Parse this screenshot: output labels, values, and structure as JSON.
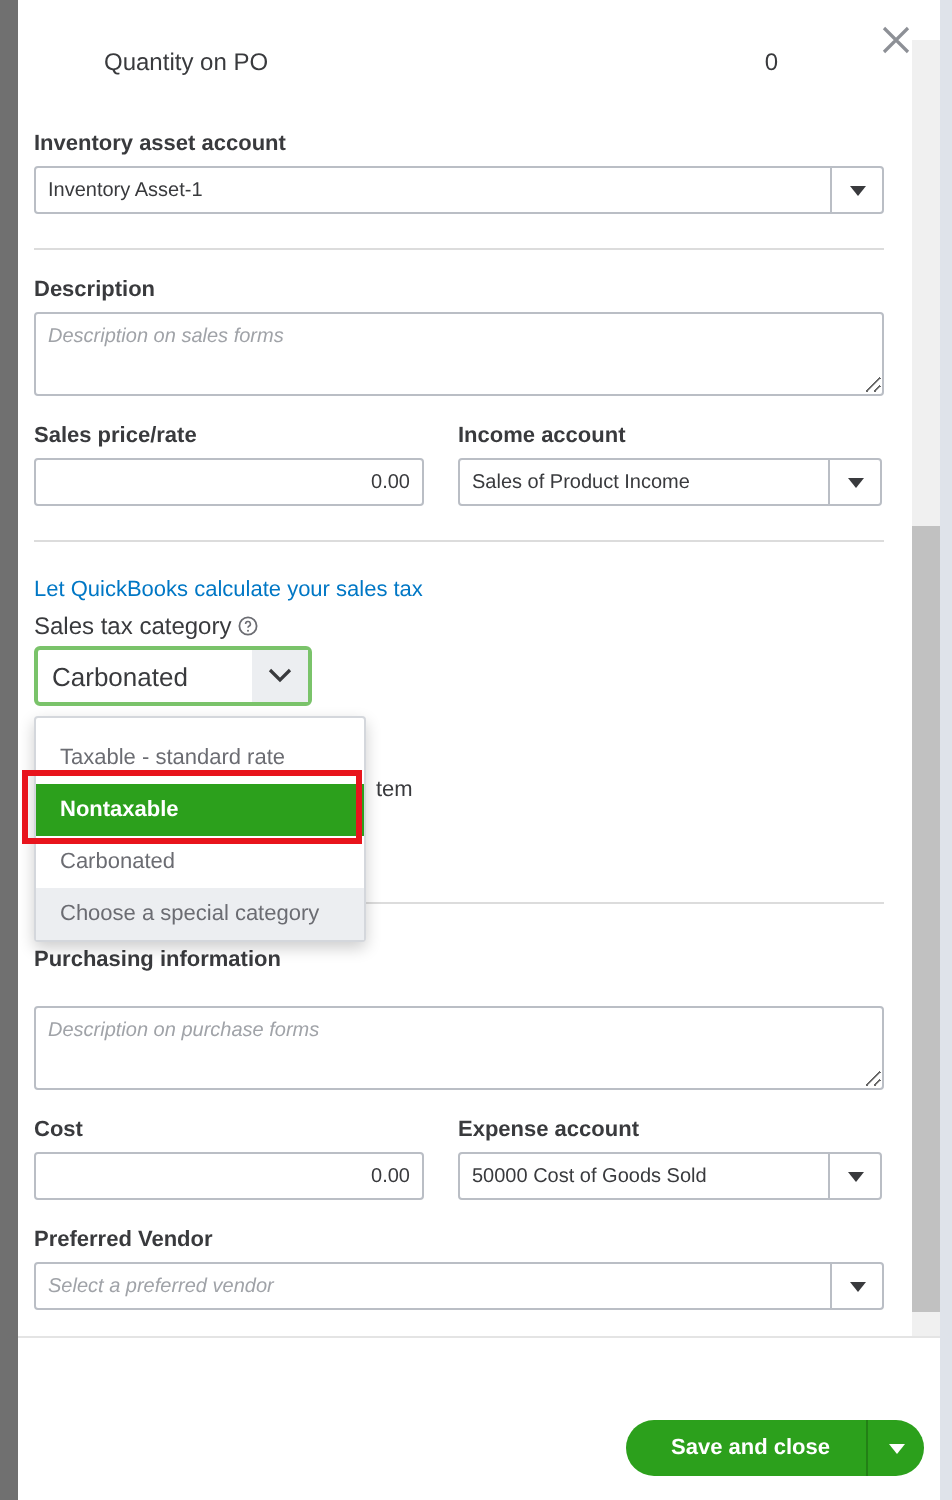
{
  "quantity_on_po": {
    "label": "Quantity on PO",
    "value": "0"
  },
  "inventory_asset_account": {
    "label": "Inventory asset account",
    "value": "Inventory Asset-1"
  },
  "description": {
    "label": "Description",
    "placeholder": "Description on sales forms"
  },
  "sales_price": {
    "label": "Sales price/rate",
    "value": "0.00"
  },
  "income_account": {
    "label": "Income account",
    "value": "Sales of Product Income"
  },
  "tax_link": "Let QuickBooks calculate your sales tax",
  "sales_tax_category": {
    "label": "Sales tax category",
    "value": "Carbonated",
    "expanded": true,
    "options": [
      {
        "label": "Taxable - standard rate",
        "kind": "option",
        "highlighted": false,
        "annotated": false
      },
      {
        "label": "Nontaxable",
        "kind": "option",
        "highlighted": true,
        "annotated": true
      },
      {
        "label": "Carbonated",
        "kind": "option",
        "highlighted": false,
        "annotated": false
      },
      {
        "label": "Choose a special category",
        "kind": "special",
        "highlighted": false,
        "annotated": false
      }
    ]
  },
  "covered_row_text": "tem",
  "purchasing": {
    "heading": "Purchasing information",
    "placeholder": "Description on purchase forms"
  },
  "cost": {
    "label": "Cost",
    "value": "0.00"
  },
  "expense_account": {
    "label": "Expense account",
    "value": "50000 Cost of Goods Sold"
  },
  "preferred_vendor": {
    "label": "Preferred Vendor",
    "placeholder": "Select a preferred vendor"
  },
  "save_button": {
    "label": "Save and close"
  }
}
